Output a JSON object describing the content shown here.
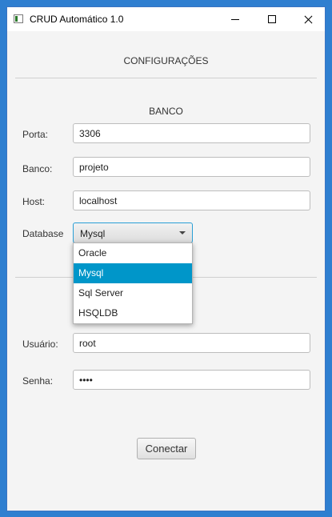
{
  "window": {
    "title": "CRUD Automático 1.0"
  },
  "config": {
    "heading": "CONFIGURAÇÕES"
  },
  "banco": {
    "heading": "BANCO",
    "porta_label": "Porta:",
    "porta_value": "3306",
    "banco_label": "Banco:",
    "banco_value": "projeto",
    "host_label": "Host:",
    "host_value": "localhost",
    "database_label": "Database",
    "database_selected": "Mysql",
    "database_options": [
      "Oracle",
      "Mysql",
      "Sql Server",
      "HSQLDB"
    ]
  },
  "login": {
    "usuario_label": "Usuário:",
    "usuario_value": "root",
    "senha_label": "Senha:",
    "senha_value": "root"
  },
  "actions": {
    "connect_label": "Conectar"
  },
  "colors": {
    "selection": "#0096c9",
    "focus_border": "#2a9fd6",
    "desktop": "#2f7fd0"
  },
  "icons": {
    "app": "app-window-icon",
    "minimize": "minimize-icon",
    "maximize": "maximize-icon",
    "close": "close-icon",
    "dropdown": "chevron-down-icon"
  }
}
